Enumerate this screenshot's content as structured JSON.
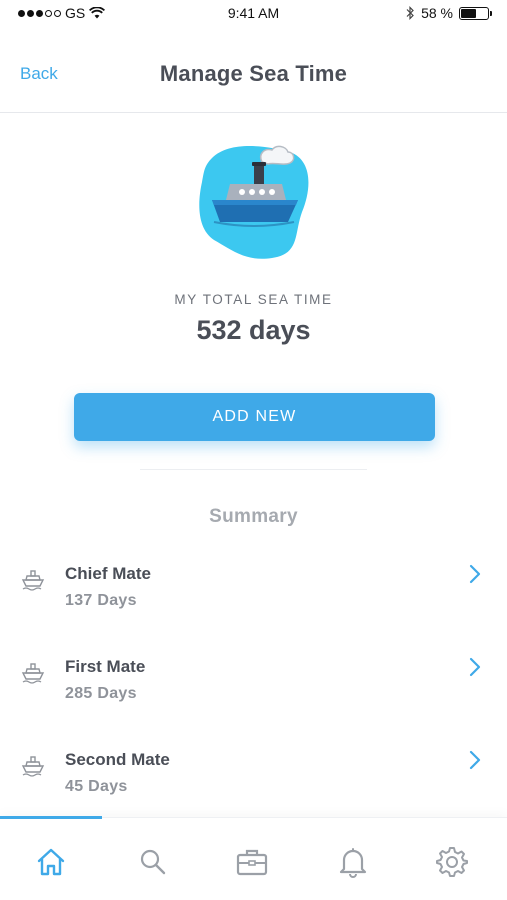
{
  "status_bar": {
    "carrier": "GS",
    "time": "9:41 AM",
    "battery_text": "58 %",
    "battery_level": 0.58
  },
  "nav": {
    "back_label": "Back",
    "title": "Manage Sea Time"
  },
  "summary_card": {
    "total_label": "MY TOTAL SEA TIME",
    "total_value": "532 days",
    "add_button_label": "ADD NEW"
  },
  "summary": {
    "heading": "Summary",
    "items": [
      {
        "title": "Chief Mate",
        "days": "137 Days",
        "icon": "ship-icon"
      },
      {
        "title": "First Mate",
        "days": "285 Days",
        "icon": "ship-icon"
      },
      {
        "title": "Second Mate",
        "days": "45 Days",
        "icon": "ship-icon"
      }
    ]
  },
  "tab_bar": {
    "tabs": [
      {
        "icon": "home-icon",
        "active": true
      },
      {
        "icon": "search-icon",
        "active": false
      },
      {
        "icon": "briefcase-icon",
        "active": false
      },
      {
        "icon": "bell-icon",
        "active": false
      },
      {
        "icon": "gear-icon",
        "active": false
      }
    ]
  },
  "colors": {
    "accent": "#3fa9e8",
    "title_text": "#4a4e57",
    "muted_text": "#8f939a",
    "ship_blob": "#3cc8f0",
    "ship_hull": "#1f6fb2"
  }
}
